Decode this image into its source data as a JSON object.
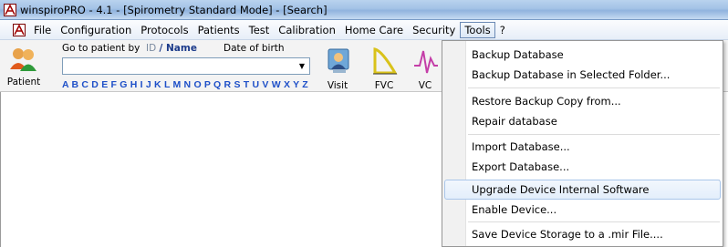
{
  "window": {
    "title": "winspiroPRO - 4.1 - [Spirometry Standard Mode] - [Search]"
  },
  "menubar": {
    "items": [
      "File",
      "Configuration",
      "Protocols",
      "Patients",
      "Test",
      "Calibration",
      "Home Care",
      "Security",
      "Tools",
      "?"
    ],
    "active": "Tools"
  },
  "toolbar": {
    "patient_label": "Patient",
    "goto_label": "Go to patient by",
    "id_label": "ID",
    "name_label": "/ Name",
    "dob_label": "Date of birth",
    "search_value": "",
    "alphabet": "A B C D E F G H I J K L M N O P Q R S T U V W X Y Z",
    "visit_label": "Visit",
    "fvc_label": "FVC",
    "vc_label": "VC"
  },
  "tools_menu": {
    "items": [
      "Backup Database",
      "Backup Database in Selected Folder...",
      "Restore Backup Copy from...",
      "Repair database",
      "Import Database...",
      "Export Database...",
      "Upgrade Device Internal Software",
      "Enable Device...",
      "Save Device Storage to a .mir File...."
    ],
    "highlighted": "Upgrade Device Internal Software"
  },
  "colors": {
    "accent": "#1f50c8",
    "menu_highlight": "#a9c6ea",
    "titlebar": "#a3c2e6"
  }
}
